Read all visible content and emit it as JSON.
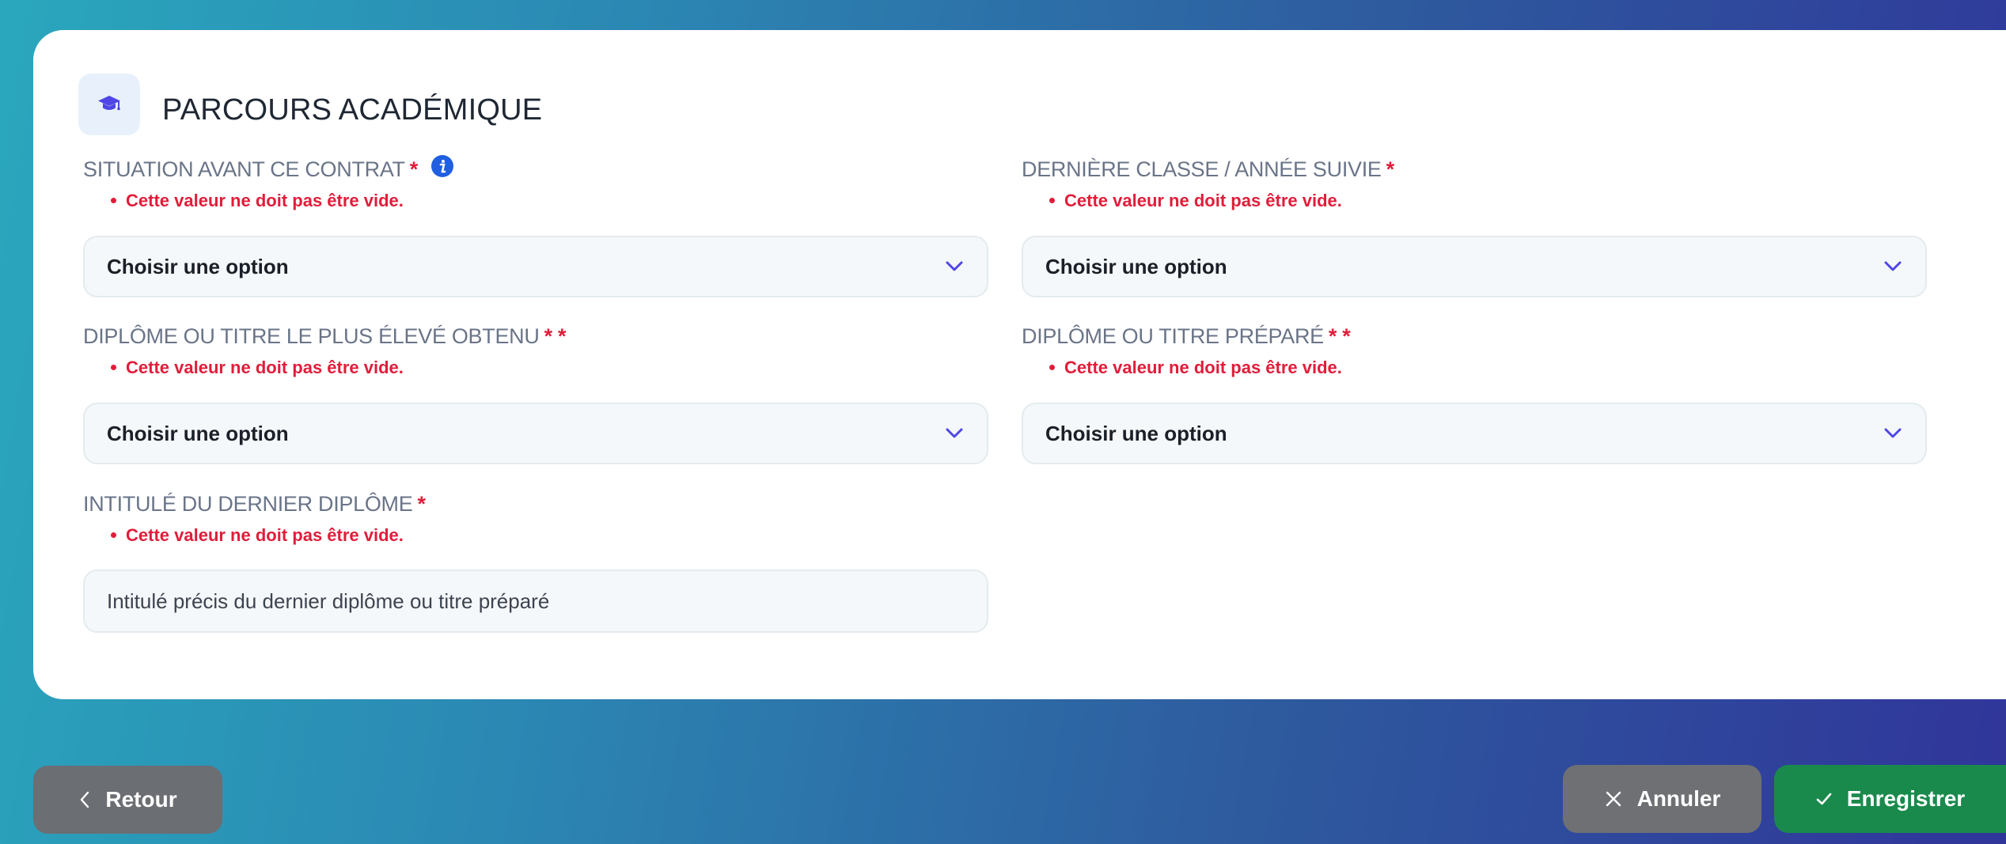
{
  "section": {
    "title": "PARCOURS ACADÉMIQUE",
    "icon": "graduation-cap-icon"
  },
  "fields": {
    "situation": {
      "label": "SITUATION AVANT CE CONTRAT",
      "required_mark": "*",
      "error": "Cette valeur ne doit pas être vide.",
      "value": "Choisir une option"
    },
    "derniere_classe": {
      "label": "DERNIÈRE CLASSE / ANNÉE SUIVIE",
      "required_mark": "*",
      "error": "Cette valeur ne doit pas être vide.",
      "value": "Choisir une option"
    },
    "diplome_obtenu": {
      "label": "DIPLÔME OU TITRE LE PLUS ÉLEVÉ OBTENU",
      "required_mark": "* *",
      "error": "Cette valeur ne doit pas être vide.",
      "value": "Choisir une option"
    },
    "diplome_prepare": {
      "label": "DIPLÔME OU TITRE PRÉPARÉ",
      "required_mark": "* *",
      "error": "Cette valeur ne doit pas être vide.",
      "value": "Choisir une option"
    },
    "intitule": {
      "label": "INTITULÉ DU DERNIER DIPLÔME",
      "required_mark": "*",
      "error": "Cette valeur ne doit pas être vide.",
      "value": "",
      "placeholder": "Intitulé précis du dernier diplôme ou titre préparé"
    }
  },
  "actions": {
    "back": "Retour",
    "cancel": "Annuler",
    "save": "Enregistrer"
  },
  "colors": {
    "error": "#e11d3a",
    "accent": "#4f46e5",
    "save": "#1a8a4c",
    "neutral_button": "#6b6e72"
  }
}
